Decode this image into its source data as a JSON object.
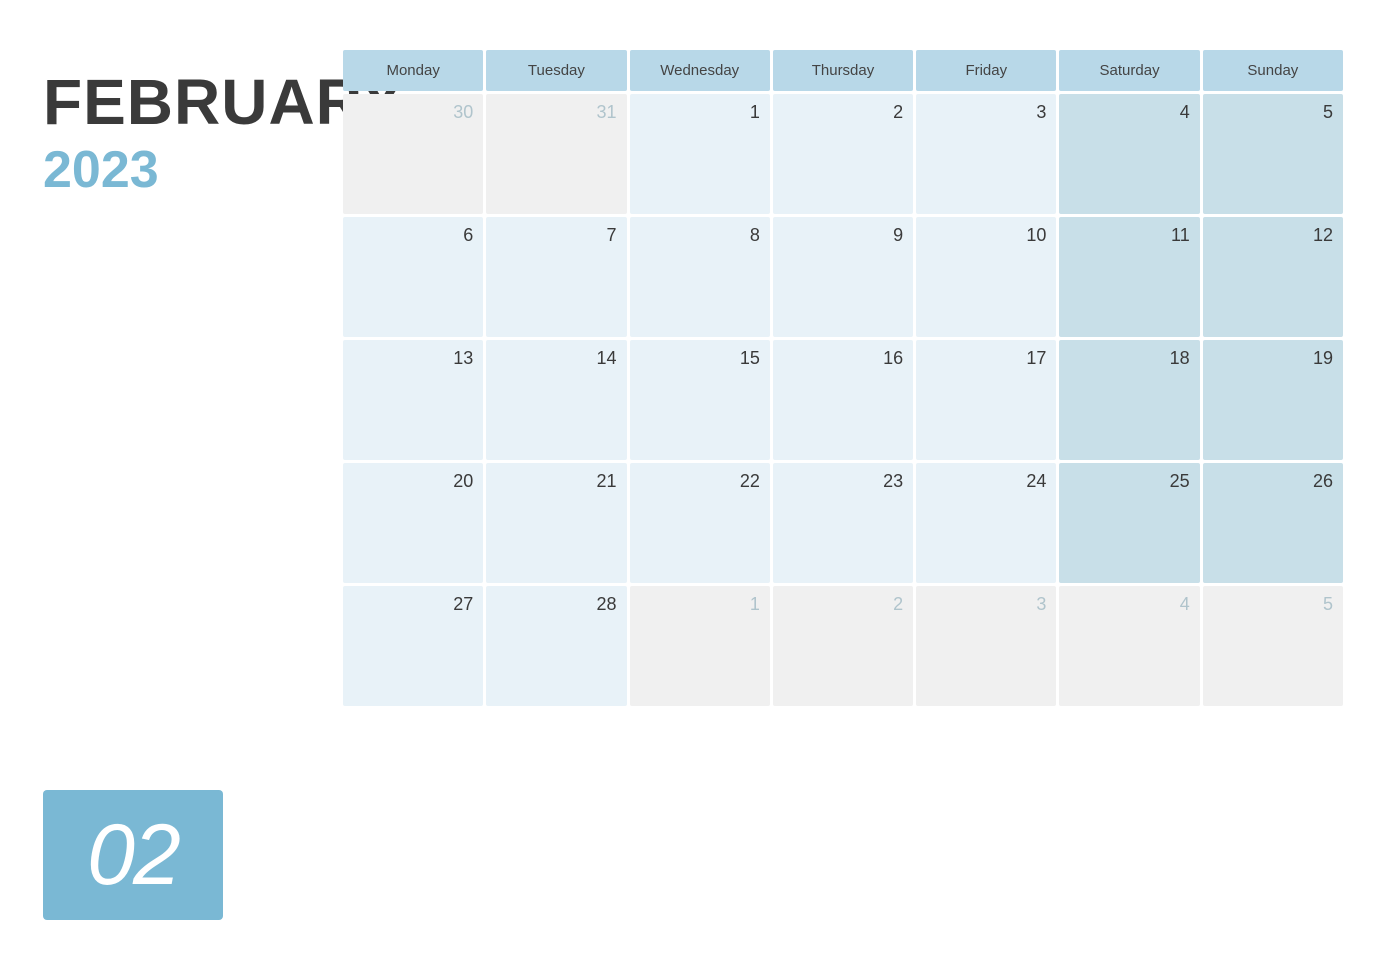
{
  "header": {
    "month": "FEBRUARY",
    "year": "2023",
    "badge": "02"
  },
  "weekdays": [
    {
      "label": "Monday"
    },
    {
      "label": "Tuesday"
    },
    {
      "label": "Wednesday"
    },
    {
      "label": "Thursday"
    },
    {
      "label": "Friday"
    },
    {
      "label": "Saturday"
    },
    {
      "label": "Sunday"
    }
  ],
  "weeks": [
    [
      {
        "day": "30",
        "type": "prev"
      },
      {
        "day": "31",
        "type": "prev"
      },
      {
        "day": "1",
        "type": "current"
      },
      {
        "day": "2",
        "type": "current"
      },
      {
        "day": "3",
        "type": "current"
      },
      {
        "day": "4",
        "type": "weekend"
      },
      {
        "day": "5",
        "type": "weekend"
      }
    ],
    [
      {
        "day": "6",
        "type": "current"
      },
      {
        "day": "7",
        "type": "current"
      },
      {
        "day": "8",
        "type": "current"
      },
      {
        "day": "9",
        "type": "current"
      },
      {
        "day": "10",
        "type": "current"
      },
      {
        "day": "11",
        "type": "weekend"
      },
      {
        "day": "12",
        "type": "weekend"
      }
    ],
    [
      {
        "day": "13",
        "type": "current"
      },
      {
        "day": "14",
        "type": "current"
      },
      {
        "day": "15",
        "type": "current"
      },
      {
        "day": "16",
        "type": "current"
      },
      {
        "day": "17",
        "type": "current"
      },
      {
        "day": "18",
        "type": "weekend"
      },
      {
        "day": "19",
        "type": "weekend"
      }
    ],
    [
      {
        "day": "20",
        "type": "current"
      },
      {
        "day": "21",
        "type": "current"
      },
      {
        "day": "22",
        "type": "current"
      },
      {
        "day": "23",
        "type": "current"
      },
      {
        "day": "24",
        "type": "current"
      },
      {
        "day": "25",
        "type": "weekend"
      },
      {
        "day": "26",
        "type": "weekend"
      }
    ],
    [
      {
        "day": "27",
        "type": "current"
      },
      {
        "day": "28",
        "type": "current"
      },
      {
        "day": "1",
        "type": "next"
      },
      {
        "day": "2",
        "type": "next"
      },
      {
        "day": "3",
        "type": "next"
      },
      {
        "day": "4",
        "type": "next-weekend"
      },
      {
        "day": "5",
        "type": "next-weekend"
      }
    ]
  ]
}
